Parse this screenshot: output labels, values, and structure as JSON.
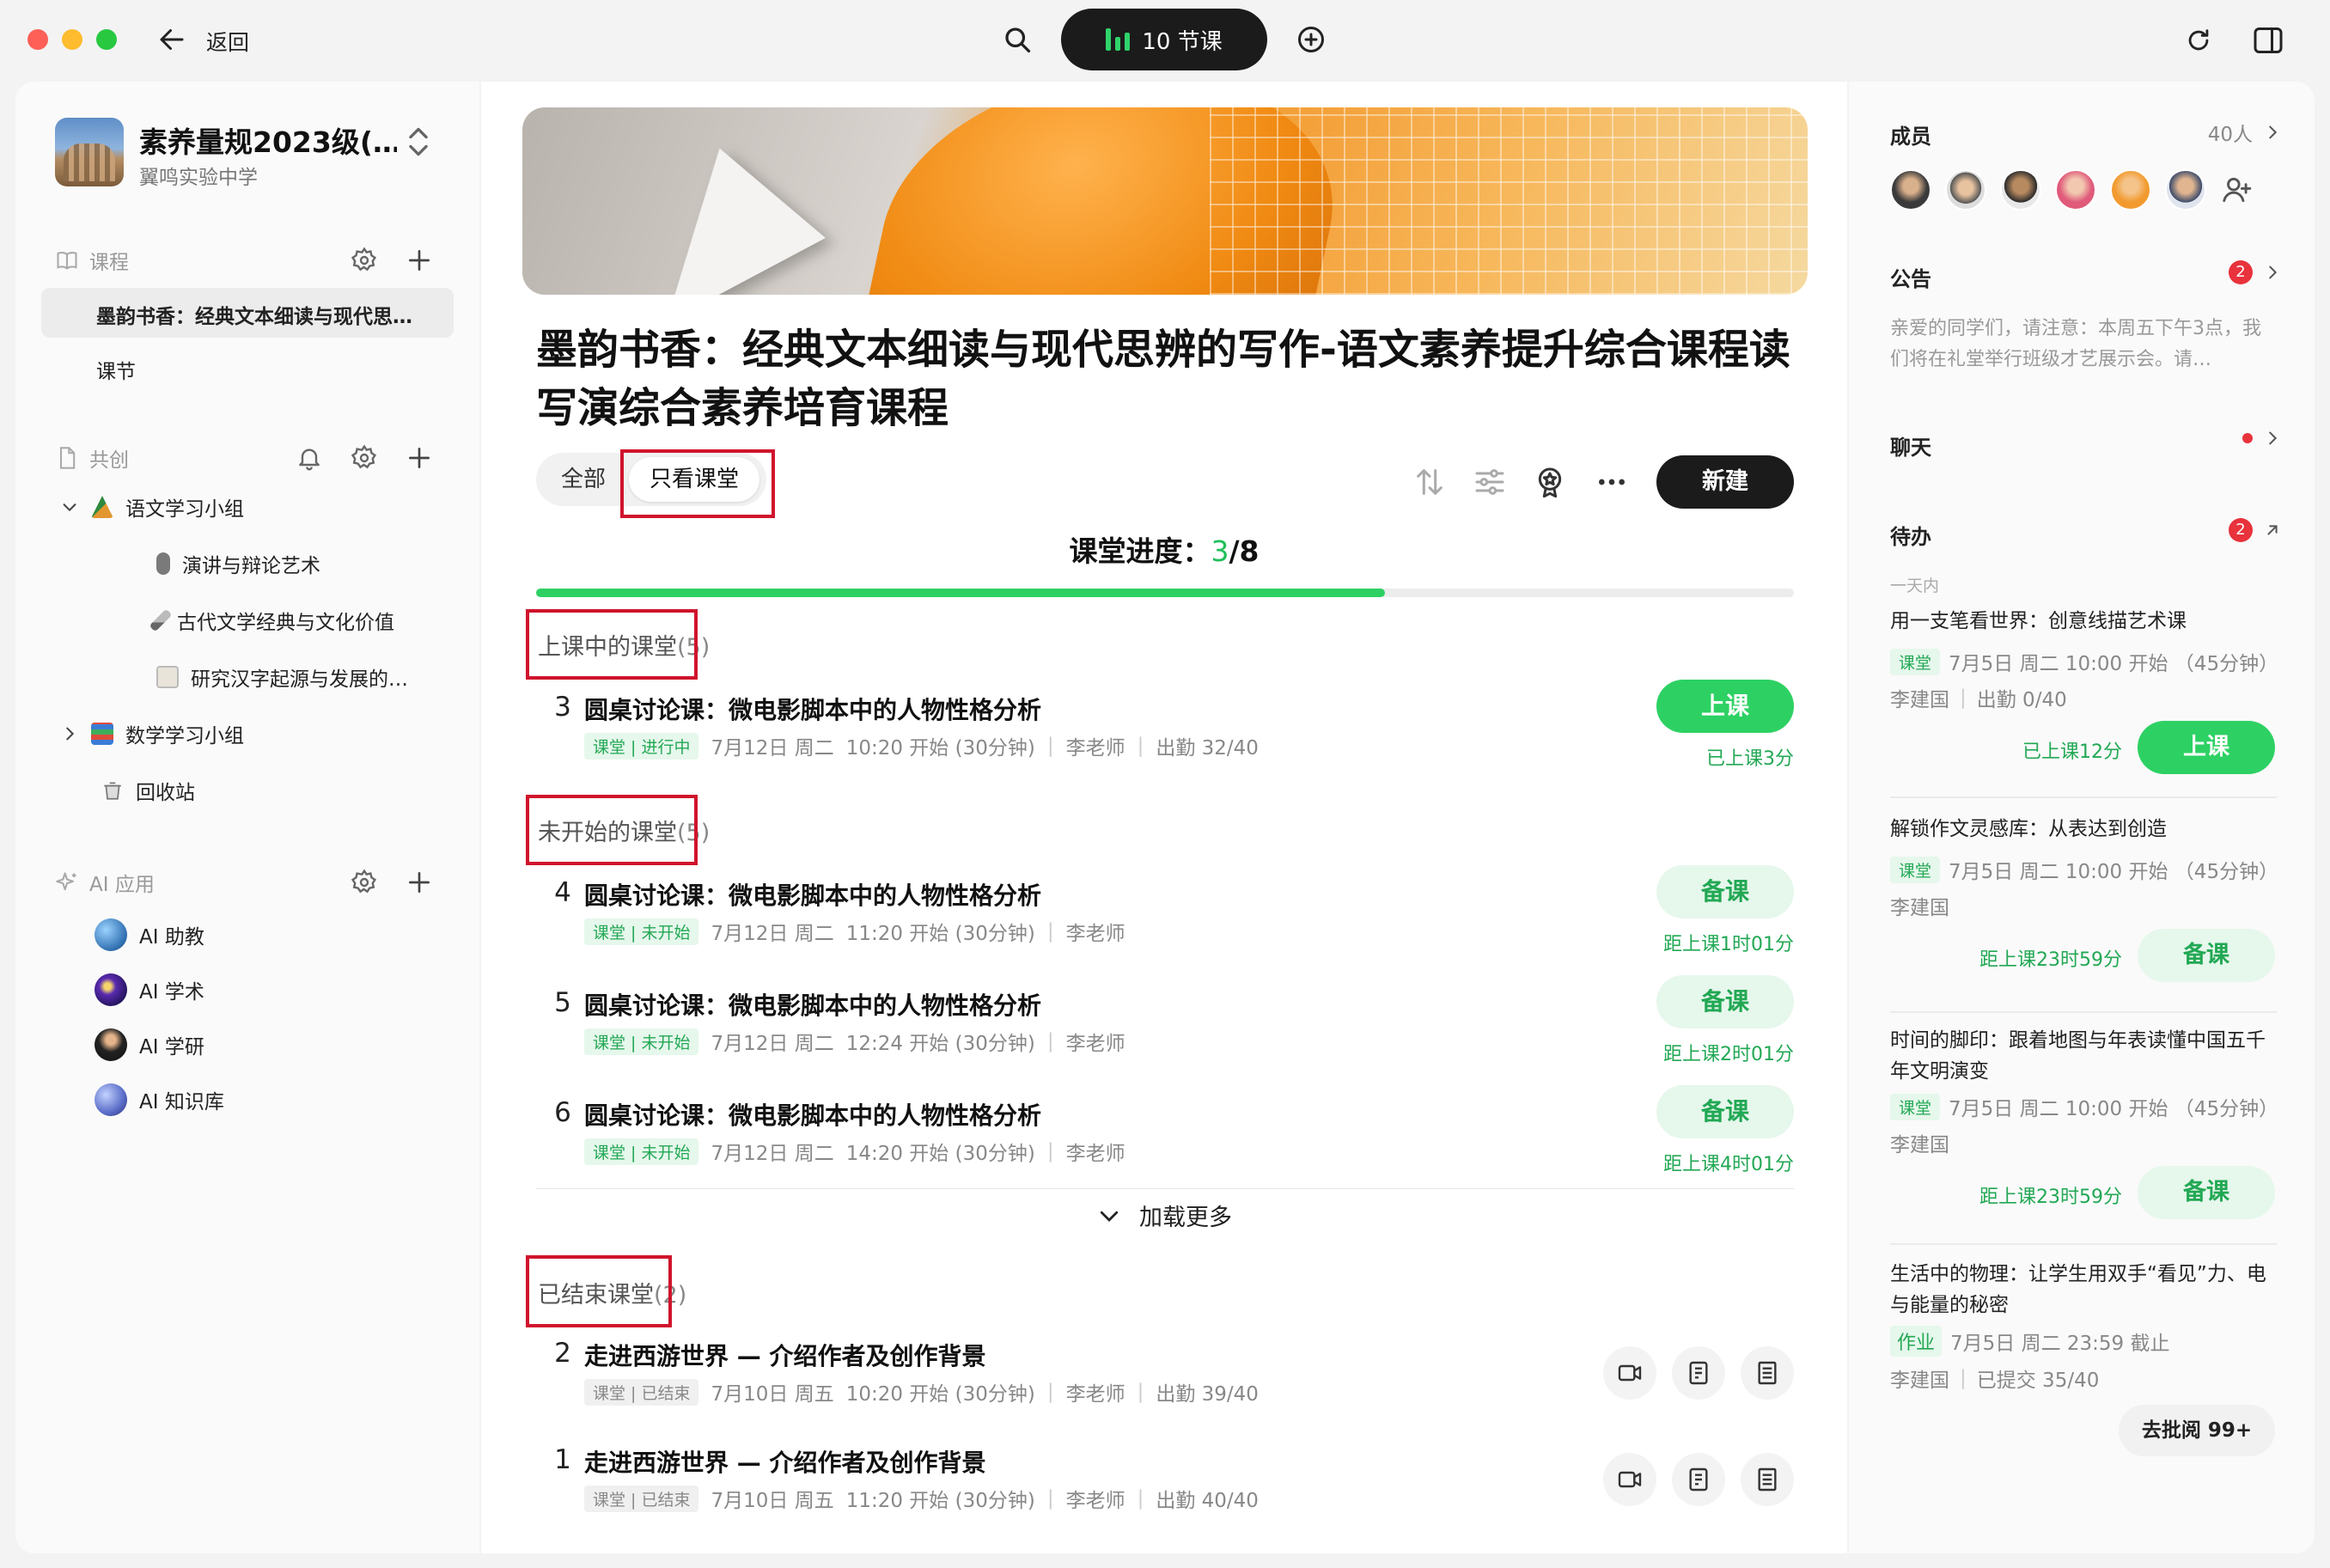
{
  "titlebar": {
    "back_label": "返回",
    "pill_label": "10 节课"
  },
  "sidebar": {
    "school_name": "素养量规2023级(…",
    "school_sub": "翼鸣实验中学",
    "courses_label": "课程",
    "course_active": "墨韵书香：经典文本细读与现代思…",
    "course_lessons": "课节",
    "cocreate_label": "共创",
    "groups": [
      {
        "label": "语文学习小组",
        "expanded": true
      },
      {
        "label": "数学学习小组",
        "expanded": false
      }
    ],
    "subitems": [
      "演讲与辩论艺术",
      "古代文学经典与文化价值",
      "研究汉字起源与发展的…"
    ],
    "trash": "回收站",
    "ai_label": "AI 应用",
    "ai_items": [
      "AI 助教",
      "AI 学术",
      "AI 学研",
      "AI 知识库"
    ]
  },
  "main": {
    "title": "墨韵书香：经典文本细读与现代思辨的写作-语文素养提升综合课程读写演综合素养培育课程",
    "filter_all": "全部",
    "filter_class": "只看课堂",
    "new_button": "新建",
    "progress_prefix": "课堂进度：",
    "progress_current": "3",
    "progress_total": "/8",
    "progress_fraction": 0.675,
    "groups": {
      "ongoing": {
        "title": "上课中的课堂",
        "count": "(5)"
      },
      "upcoming": {
        "title": "未开始的课堂",
        "count": "(5)"
      },
      "ended": {
        "title": "已结束课堂",
        "count": "(2)"
      }
    },
    "lessons_ongoing": [
      {
        "num": "3",
        "title": "圆桌讨论课：微电影脚本中的人物性格分析",
        "tag": "课堂 | 进行中",
        "date": "7月12日 周二",
        "time": "10:20 开始 (30分钟)",
        "teacher": "李老师",
        "attend": "出勤 32/40",
        "button": "上课",
        "note": "已上课3分"
      }
    ],
    "lessons_upcoming": [
      {
        "num": "4",
        "title": "圆桌讨论课：微电影脚本中的人物性格分析",
        "tag": "课堂 | 未开始",
        "date": "7月12日 周二",
        "time": "11:20 开始 (30分钟)",
        "teacher": "李老师",
        "button": "备课",
        "note": "距上课1时01分"
      },
      {
        "num": "5",
        "title": "圆桌讨论课：微电影脚本中的人物性格分析",
        "tag": "课堂 | 未开始",
        "date": "7月12日 周二",
        "time": "12:24 开始 (30分钟)",
        "teacher": "李老师",
        "button": "备课",
        "note": "距上课2时01分"
      },
      {
        "num": "6",
        "title": "圆桌讨论课：微电影脚本中的人物性格分析",
        "tag": "课堂 | 未开始",
        "date": "7月12日 周二",
        "time": "14:20 开始 (30分钟)",
        "teacher": "李老师",
        "button": "备课",
        "note": "距上课4时01分"
      }
    ],
    "load_more": "加载更多",
    "lessons_ended": [
      {
        "num": "2",
        "title": "走进西游世界 — 介绍作者及创作背景",
        "tag": "课堂 | 已结束",
        "date": "7月10日 周五",
        "time": "10:20 开始 (30分钟)",
        "teacher": "李老师",
        "attend": "出勤 39/40"
      },
      {
        "num": "1",
        "title": "走进西游世界 — 介绍作者及创作背景",
        "tag": "课堂 | 已结束",
        "date": "7月10日 周五",
        "time": "11:20 开始 (30分钟)",
        "teacher": "李老师",
        "attend": "出勤 40/40"
      }
    ]
  },
  "right": {
    "members_label": "成员",
    "members_count": "40人",
    "notice_label": "公告",
    "notice_badge": "2",
    "notice_text": "亲爱的同学们，请注意：本周五下午3点，我们将在礼堂举行班级才艺展示会。请…",
    "chat_label": "聊天",
    "todo_label": "待办",
    "todo_badge": "2",
    "todo_period": "一天内",
    "todos": [
      {
        "title": "用一支笔看世界：创意线描艺术课",
        "tag": "课堂",
        "meta": "7月5日 周二 10:00 开始 （45分钟）",
        "teacher": "李建国",
        "extra": "出勤 0/40",
        "note": "已上课12分",
        "button": "上课"
      },
      {
        "title": "解锁作文灵感库：从表达到创造",
        "tag": "课堂",
        "meta": "7月5日 周二 10:00 开始 （45分钟）",
        "teacher": "李建国",
        "note": "距上课23时59分",
        "button": "备课"
      },
      {
        "title": "时间的脚印：跟着地图与年表读懂中国五千年文明演变",
        "tag": "课堂",
        "meta": "7月5日 周二 10:00 开始 （45分钟）",
        "teacher": "李建国",
        "note": "距上课23时59分",
        "button": "备课"
      },
      {
        "title": "生活中的物理：让学生用双手“看见”力、电与能量的秘密",
        "tag": "作业",
        "meta": "7月5日 周二 23:59 截止",
        "teacher": "李建国",
        "extra": "已提交 35/40"
      }
    ],
    "review_button": "去批阅 99+"
  },
  "colors": {
    "accent_green": "#2dd163",
    "dark": "#1b1b1b",
    "highlight_red": "#d0142c",
    "badge_red": "#e8323c"
  }
}
